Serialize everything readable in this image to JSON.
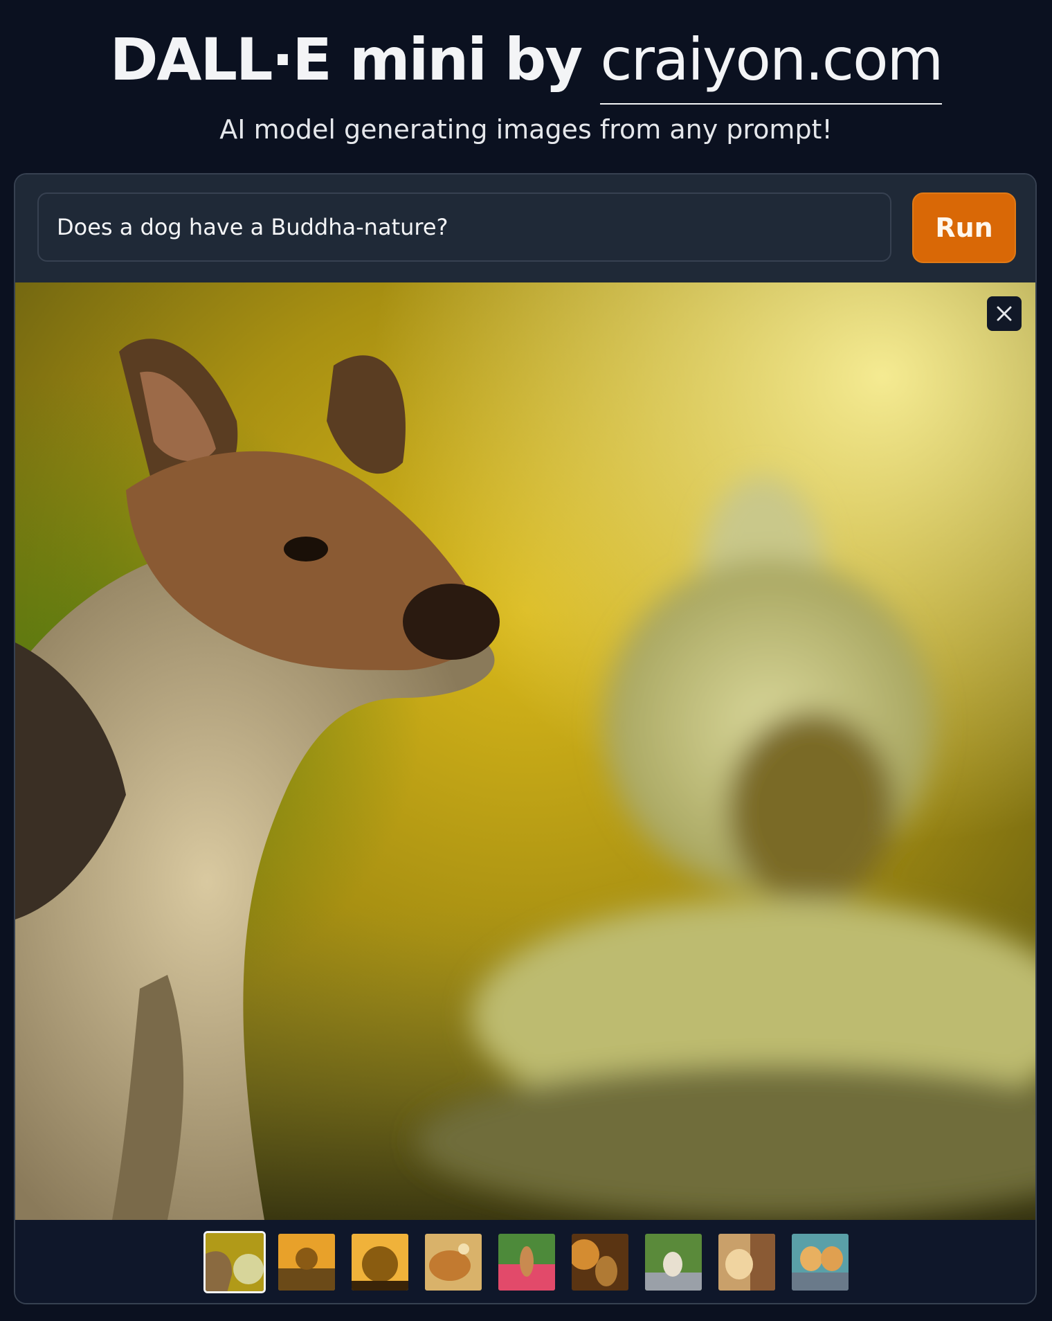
{
  "header": {
    "title_prefix": "DALL·E mini by ",
    "title_link": "craiyon.com",
    "subtitle": "AI model generating images from any prompt!"
  },
  "prompt": {
    "value": "Does a dog have a Buddha-nature?"
  },
  "run_button": {
    "label": "Run"
  },
  "gallery": {
    "close_icon": "close-icon",
    "selected_index": 0,
    "thumbnail_count": 9,
    "colors": {
      "brand_orange": "#d96806",
      "background": "#0b1120",
      "panel": "#1f2937"
    }
  }
}
